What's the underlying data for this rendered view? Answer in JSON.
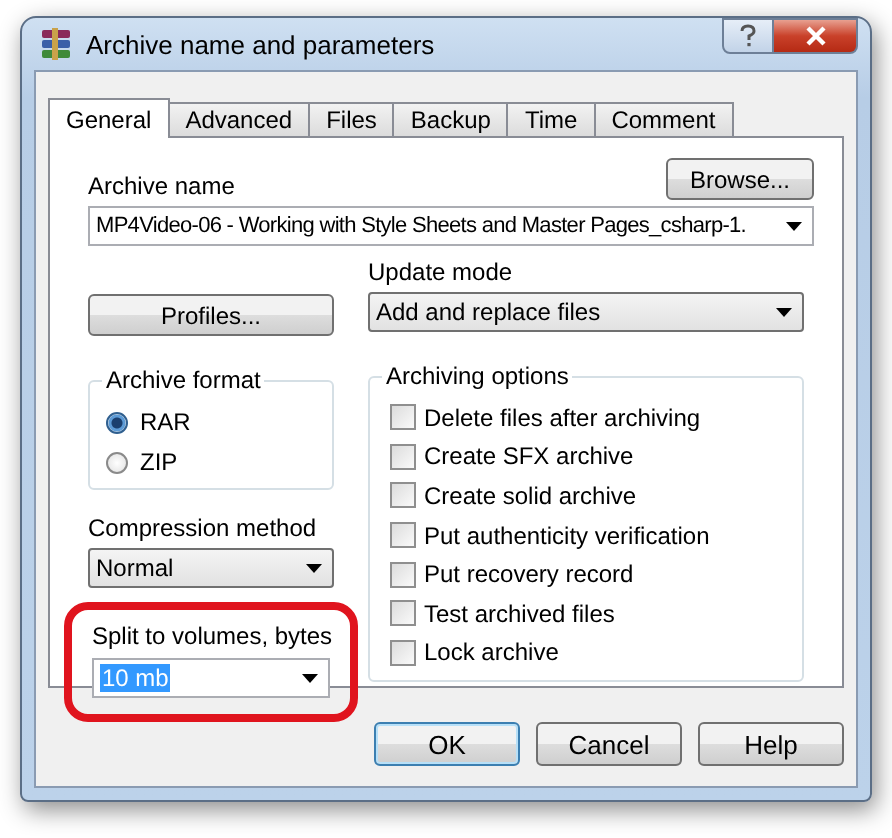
{
  "window": {
    "title": "Archive name and parameters"
  },
  "tabs": [
    {
      "label": "General",
      "selected": true
    },
    {
      "label": "Advanced",
      "selected": false
    },
    {
      "label": "Files",
      "selected": false
    },
    {
      "label": "Backup",
      "selected": false
    },
    {
      "label": "Time",
      "selected": false
    },
    {
      "label": "Comment",
      "selected": false
    }
  ],
  "archive_name": {
    "label": "Archive name",
    "value": "MP4Video-06 - Working with Style Sheets and Master Pages_csharp-1.",
    "button": "Browse..."
  },
  "profiles_button": "Profiles...",
  "update_mode": {
    "label": "Update mode",
    "value": "Add and replace files"
  },
  "archive_format": {
    "label": "Archive format",
    "options": [
      {
        "label": "RAR",
        "selected": true
      },
      {
        "label": "ZIP",
        "selected": false
      }
    ]
  },
  "compression_method": {
    "label": "Compression method",
    "value": "Normal"
  },
  "split_volumes": {
    "label": "Split to volumes, bytes",
    "value": "10 mb",
    "text_selected": true,
    "highlighted": true
  },
  "archiving_options": {
    "label": "Archiving options",
    "items": [
      {
        "label": "Delete files after archiving",
        "checked": false
      },
      {
        "label": "Create SFX archive",
        "checked": false
      },
      {
        "label": "Create solid archive",
        "checked": false
      },
      {
        "label": "Put authenticity verification",
        "checked": false
      },
      {
        "label": "Put recovery record",
        "checked": false
      },
      {
        "label": "Test archived files",
        "checked": false
      },
      {
        "label": "Lock archive",
        "checked": false
      }
    ]
  },
  "buttons": [
    {
      "label": "OK",
      "default": true
    },
    {
      "label": "Cancel",
      "default": false
    },
    {
      "label": "Help",
      "default": false
    }
  ]
}
